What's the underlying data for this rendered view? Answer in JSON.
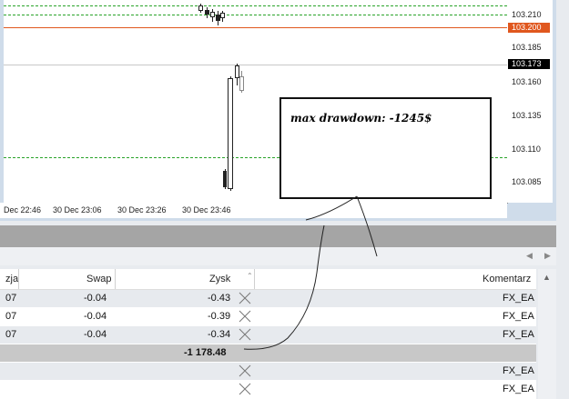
{
  "chart": {
    "price_labels": [
      "103.210",
      "103.185",
      "103.160",
      "103.135",
      "103.110",
      "103.085"
    ],
    "bid_tag": "103.200",
    "current_tag": "103.173",
    "time_labels": [
      "Dec 22:46",
      "30 Dec 23:06",
      "30 Dec 23:26",
      "30 Dec 23:46"
    ],
    "annotation": "max drawdown: -1245$",
    "colors": {
      "bid_line": "#e0571e",
      "grid_dash": "#2aa32a",
      "panel_bg": "#cfdcea"
    }
  },
  "toolbox": {
    "scroll_left_icon": "triangle-left",
    "scroll_right_icon": "triangle-right"
  },
  "table": {
    "headers": {
      "col1": "zja",
      "swap": "Swap",
      "profit": "Zysk",
      "comment": "Komentarz"
    },
    "rows": [
      {
        "c1": "07",
        "swap": "-0.04",
        "profit": "-0.43",
        "comment": "FX_EA"
      },
      {
        "c1": "07",
        "swap": "-0.04",
        "profit": "-0.39",
        "comment": "FX_EA"
      },
      {
        "c1": "07",
        "swap": "-0.04",
        "profit": "-0.34",
        "comment": "FX_EA"
      }
    ],
    "total": "-1 178.48",
    "bottom_rows": [
      {
        "comment": "FX_EA"
      },
      {
        "comment": "FX_EA"
      }
    ]
  }
}
